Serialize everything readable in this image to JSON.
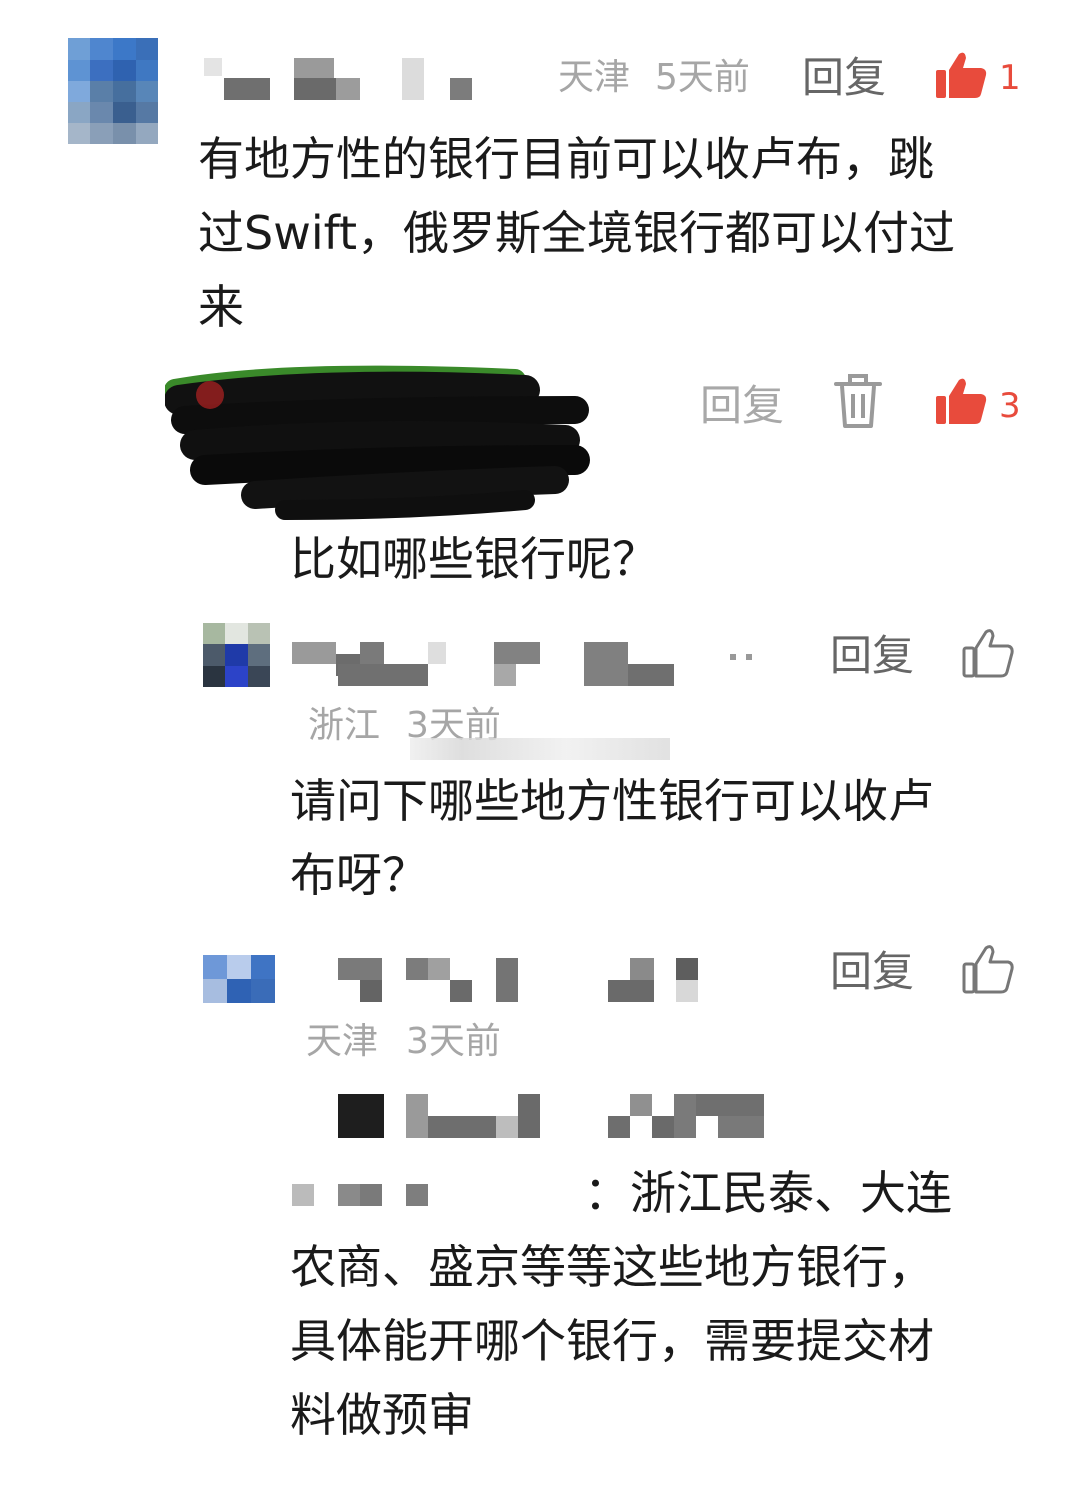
{
  "comments": [
    {
      "location": "天津",
      "time": "5天前",
      "reply_label": "回复",
      "like_count": "1",
      "text_lines": [
        "有地方性的银行目前可以收卢布，跳",
        "过Swift，俄罗斯全境银行都可以付过",
        "来"
      ]
    }
  ],
  "replies": [
    {
      "reply_label": "回复",
      "like_count": "3",
      "text": "比如哪些银行呢？"
    },
    {
      "location": "浙江",
      "time": "3天前",
      "reply_label": "回复",
      "text_lines": [
        "请问下哪些地方性银行可以收卢",
        "布呀？"
      ]
    },
    {
      "location": "天津",
      "time": "3天前",
      "reply_label": "回复",
      "text_first": "：浙江民泰、大连",
      "text_lines": [
        "农商、盛京等等这些地方银行，",
        "具体能开哪个银行，需要提交材",
        "料做预审"
      ]
    }
  ],
  "icons": {
    "like_filled": "thumbs-up-filled-icon",
    "like_outline": "thumbs-up-outline-icon",
    "delete": "trash-icon"
  },
  "colors": {
    "like_active": "#e84b3c",
    "meta": "#a6a6a6",
    "reply": "#666666"
  }
}
